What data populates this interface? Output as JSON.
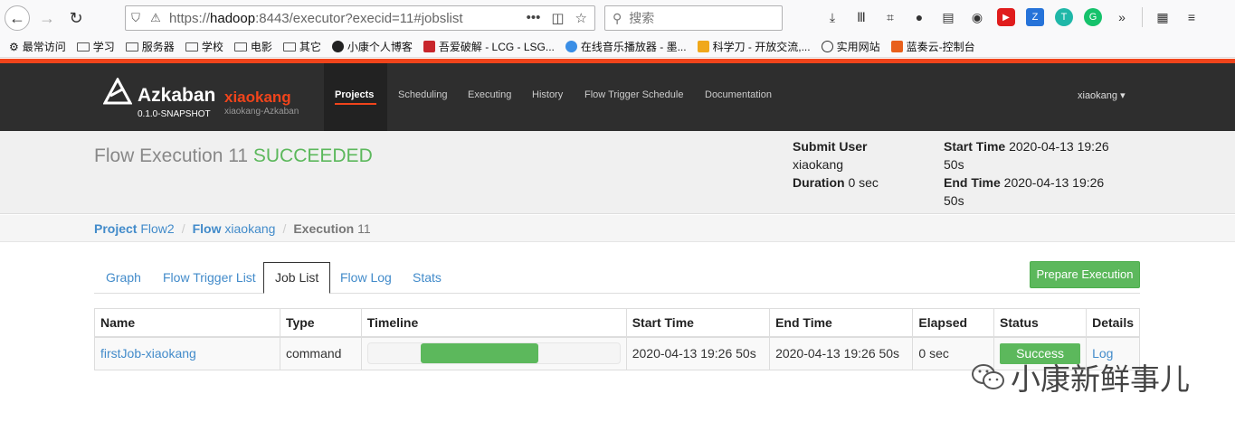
{
  "browser": {
    "url_prefix": "https://",
    "url_host": "hadoop",
    "url_rest": ":8443/executor?execid=11#jobslist",
    "search_placeholder": "搜索",
    "bookmarks": [
      "最常访问",
      "学习",
      "服务器",
      "学校",
      "电影",
      "其它",
      "小康个人博客",
      "吾爱破解 - LCG - LSG...",
      "在线音乐播放器 - 墨...",
      "科学刀 - 开放交流,...",
      "实用网站",
      "蓝奏云-控制台"
    ]
  },
  "app": {
    "brand": "Azkaban",
    "brand_sub": "xiaokang",
    "version": "0.1.0-SNAPSHOT",
    "environment": "xiaokang-Azkaban",
    "nav": [
      "Projects",
      "Scheduling",
      "Executing",
      "History",
      "Flow Trigger Schedule",
      "Documentation"
    ],
    "user": "xiaokang ▾"
  },
  "summary": {
    "title": "Flow Execution 11",
    "status": "SUCCEEDED",
    "submit_user_label": "Submit User",
    "submit_user": "xiaokang",
    "duration_label": "Duration",
    "duration": "0 sec",
    "start_time_label": "Start Time",
    "start_time": "2020-04-13 19:26",
    "start_time_sec": "50s",
    "end_time_label": "End Time",
    "end_time": "2020-04-13 19:26",
    "end_time_sec": "50s"
  },
  "breadcrumb": {
    "project_label": "Project",
    "project": "Flow2",
    "flow_label": "Flow",
    "flow": "xiaokang",
    "execution_label": "Execution",
    "execution": "11"
  },
  "tabs": [
    "Graph",
    "Flow Trigger List",
    "Job List",
    "Flow Log",
    "Stats"
  ],
  "prepare_button": "Prepare Execution",
  "table": {
    "headers": [
      "Name",
      "Type",
      "Timeline",
      "Start Time",
      "End Time",
      "Elapsed",
      "Status",
      "Details"
    ],
    "rows": [
      {
        "name": "firstJob-xiaokang",
        "type": "command",
        "start": "2020-04-13 19:26 50s",
        "end": "2020-04-13 19:26 50s",
        "elapsed": "0 sec",
        "status": "Success",
        "details": "Log"
      }
    ]
  },
  "watermark": "小康新鲜事儿"
}
